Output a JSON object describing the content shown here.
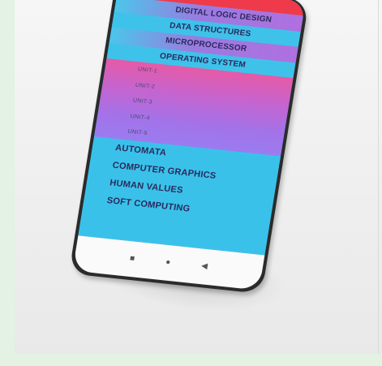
{
  "courses_top": [
    {
      "label": "DIGITAL LOGIC DESIGN"
    },
    {
      "label": "DATA STRUCTURES"
    },
    {
      "label": "MICROPROCESSOR"
    },
    {
      "label": "OPERATING SYSTEM"
    }
  ],
  "units": [
    {
      "label": "UNIT-1"
    },
    {
      "label": "UNIT-2"
    },
    {
      "label": "UNIT-3"
    },
    {
      "label": "UNIT-4"
    },
    {
      "label": "UNIT-5"
    }
  ],
  "courses_bottom": [
    {
      "label": "AUTOMATA"
    },
    {
      "label": "COMPUTER GRAPHICS"
    },
    {
      "label": "HUMAN VALUES"
    },
    {
      "label": "SOFT COMPUTING"
    }
  ],
  "nav": {
    "recents_icon": "■",
    "home_icon": "●",
    "back_icon": "◀"
  },
  "colors": {
    "status_bar": "#ef3a4b",
    "list_blue": "#3fc2ea",
    "unit_pink": "#e65aa6",
    "unit_violet": "#9a7cf0",
    "text": "#2b2a5c"
  }
}
